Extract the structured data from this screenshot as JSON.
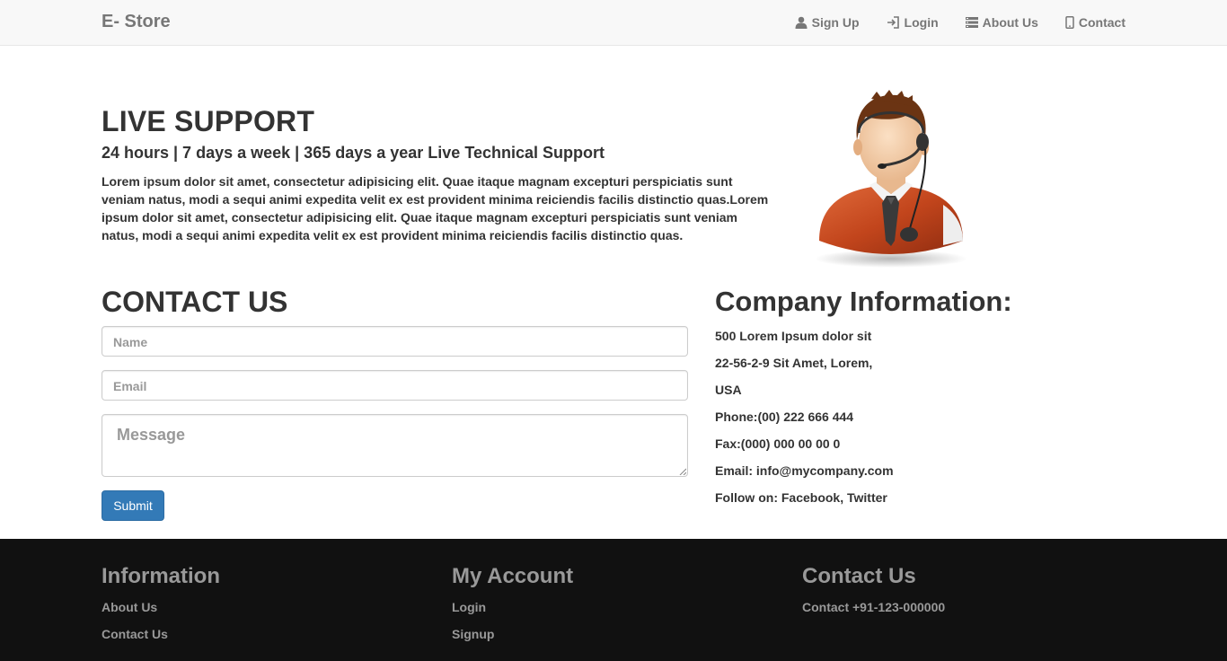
{
  "nav": {
    "brand": "E- Store",
    "links": [
      {
        "label": "Sign Up",
        "icon": "user-icon"
      },
      {
        "label": "Login",
        "icon": "login-icon"
      },
      {
        "label": "About Us",
        "icon": "list-icon"
      },
      {
        "label": "Contact",
        "icon": "phone-icon"
      }
    ]
  },
  "live_support": {
    "title": "LIVE SUPPORT",
    "subtitle": "24 hours | 7 days a week | 365 days a year Live Technical Support",
    "body": "Lorem ipsum dolor sit amet, consectetur adipisicing elit. Quae itaque magnam excepturi perspiciatis sunt veniam natus, modi a sequi animi expedita velit ex est provident minima reiciendis facilis distinctio quas.Lorem ipsum dolor sit amet, consectetur adipisicing elit. Quae itaque magnam excepturi perspiciatis sunt veniam natus, modi a sequi animi expedita velit ex est provident minima reiciendis facilis distinctio quas."
  },
  "contact_form": {
    "title": "CONTACT US",
    "name_placeholder": "Name",
    "email_placeholder": "Email",
    "message_placeholder": "Message",
    "submit_label": "Submit"
  },
  "company": {
    "title": "Company Information:",
    "lines": [
      "500 Lorem Ipsum dolor sit",
      "22-56-2-9 Sit Amet, Lorem,",
      "USA",
      "Phone:(00) 222 666 444",
      "Fax:(000) 000 00 00 0",
      "Email: info@mycompany.com",
      "Follow on: Facebook, Twitter"
    ]
  },
  "footer": {
    "information": {
      "title": "Information",
      "links": [
        "About Us",
        "Contact Us"
      ]
    },
    "account": {
      "title": "My Account",
      "links": [
        "Login",
        "Signup"
      ]
    },
    "contact": {
      "title": "Contact Us",
      "text": "Contact +91-123-000000"
    }
  },
  "colors": {
    "navbar_bg": "#f8f8f8",
    "primary_button": "#337ab7",
    "footer_bg": "#111111",
    "footer_text": "#999999"
  }
}
